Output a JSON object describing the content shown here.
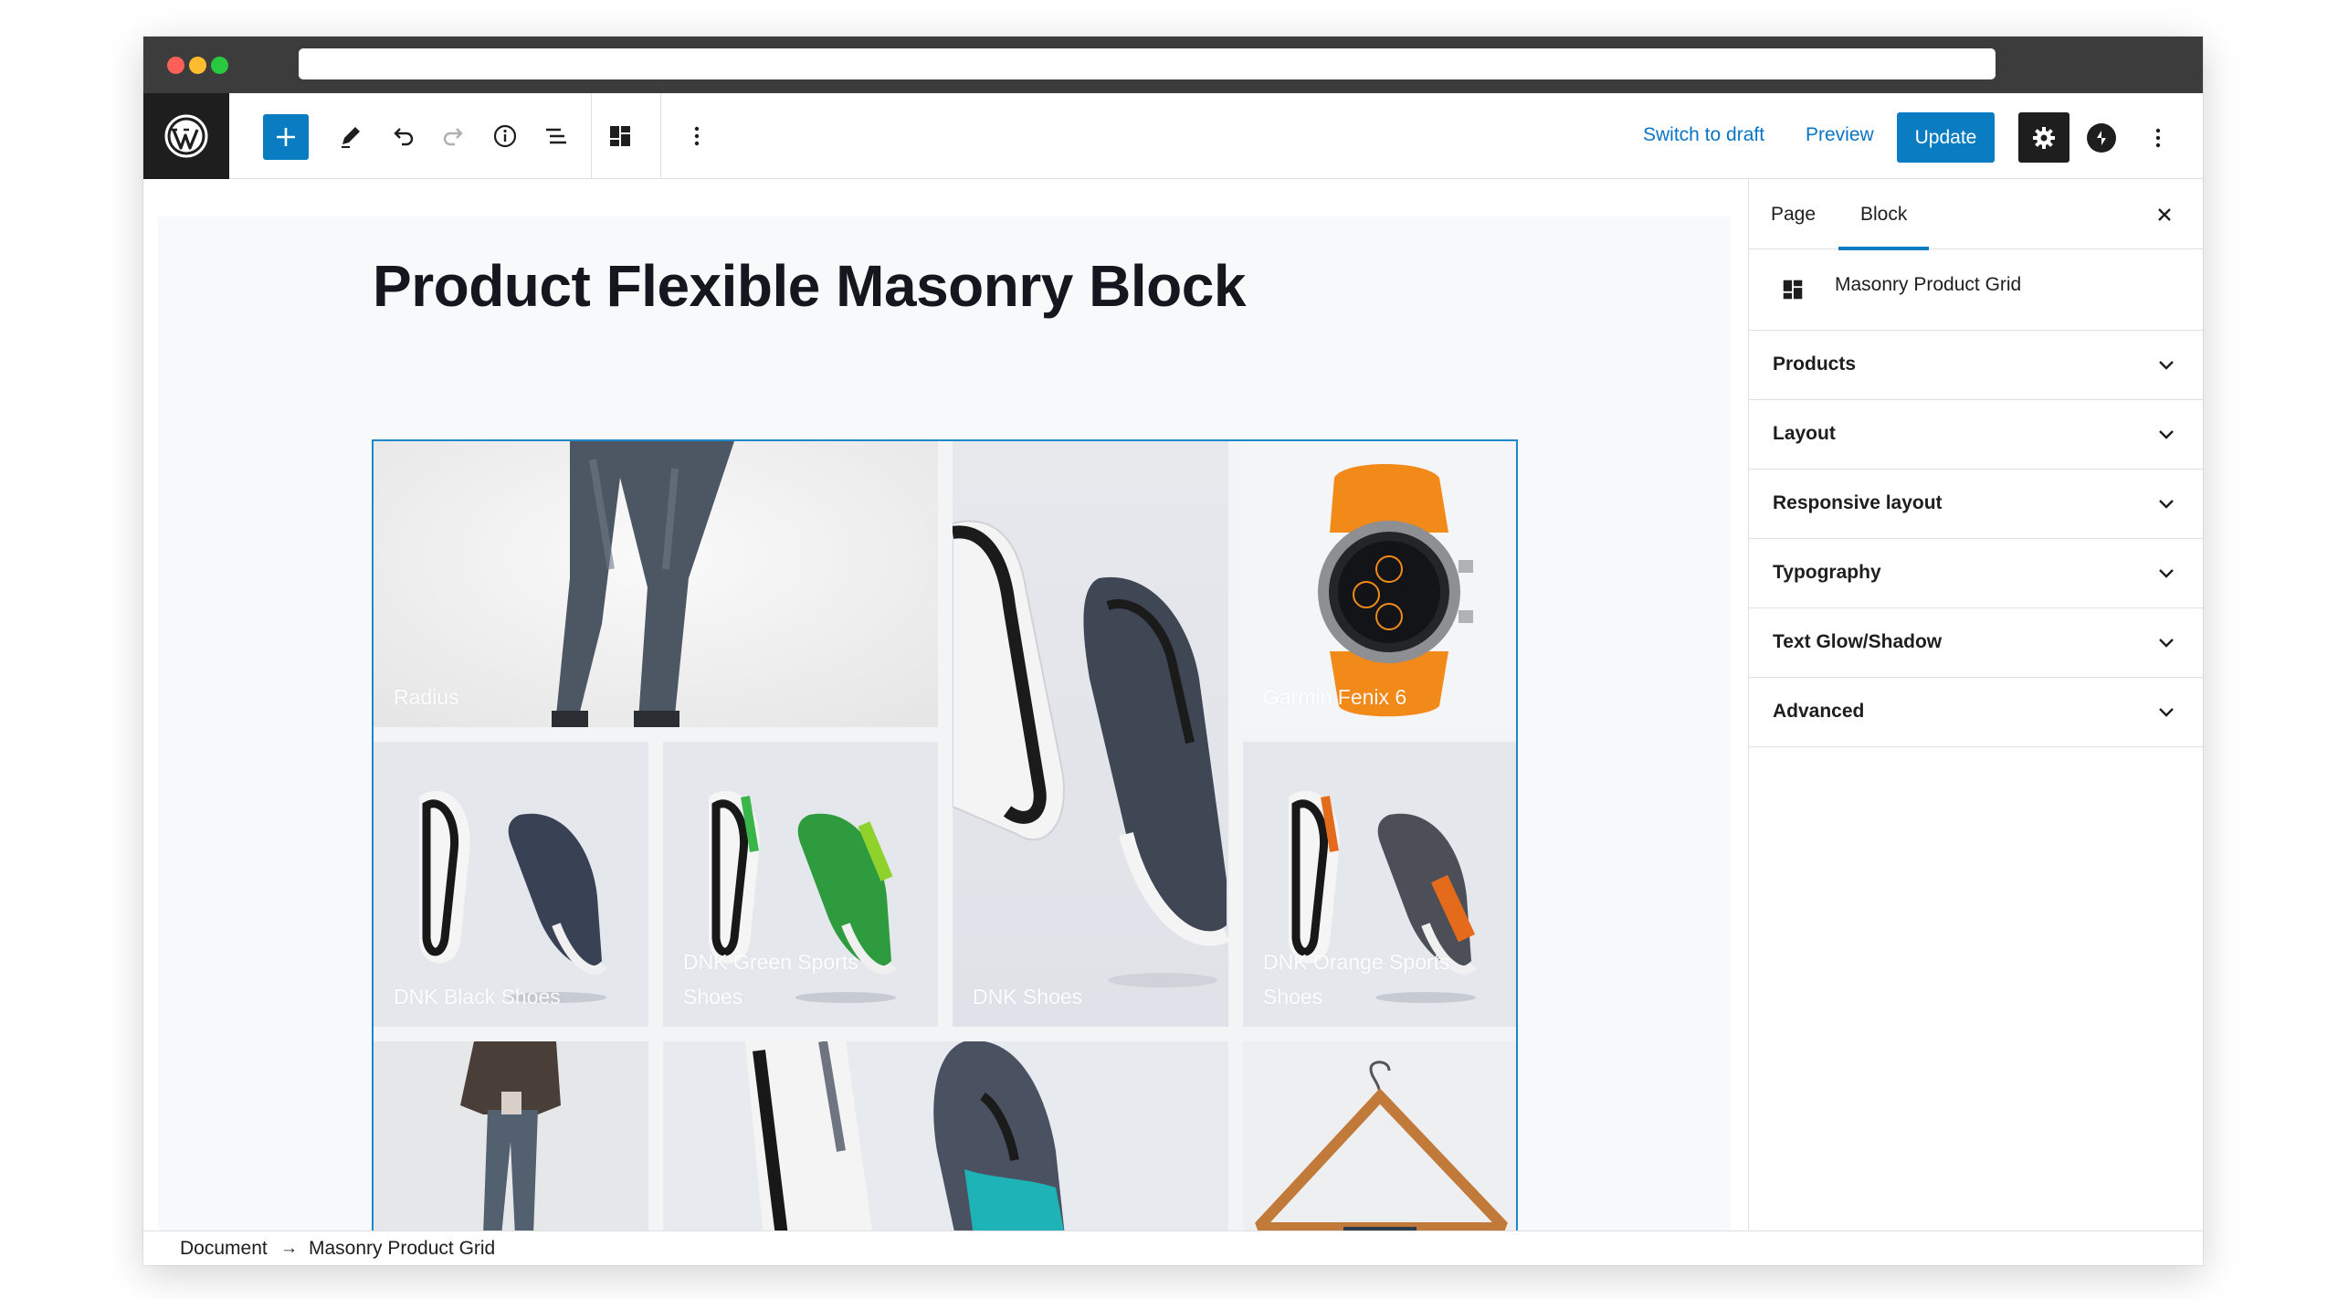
{
  "toolbar": {
    "switch_to_draft": "Switch to draft",
    "preview": "Preview",
    "update": "Update",
    "icons": [
      "wordpress-logo",
      "plus",
      "pencil",
      "undo",
      "redo",
      "info",
      "list-view",
      "masonry-block",
      "more-vertical",
      "gear",
      "jetpack",
      "more-vertical"
    ]
  },
  "page": {
    "title": "Product Flexible Masonry Block"
  },
  "grid": {
    "tiles": [
      {
        "label": "Radius"
      },
      {
        "label": "DNK Shoes"
      },
      {
        "label": "Garmin Fenix 6"
      },
      {
        "label": "DNK Black Shoes"
      },
      {
        "label": "DNK Green Sports Shoes"
      },
      {
        "label": "DNK Orange Sports Shoes"
      },
      {
        "label": ""
      },
      {
        "label": ""
      },
      {
        "label": ""
      }
    ]
  },
  "sidebar": {
    "tabs": [
      "Page",
      "Block"
    ],
    "active_tab": "Block",
    "block_name": "Masonry Product Grid",
    "panels": [
      "Products",
      "Layout",
      "Responsive layout",
      "Typography",
      "Text Glow/Shadow",
      "Advanced"
    ]
  },
  "breadcrumb": {
    "items": [
      "Document",
      "Masonry Product Grid"
    ]
  },
  "colors": {
    "accent": "#0a7cc1",
    "dark": "#1e1e1e",
    "orange": "#f28a1a",
    "green": "#39b54a"
  }
}
